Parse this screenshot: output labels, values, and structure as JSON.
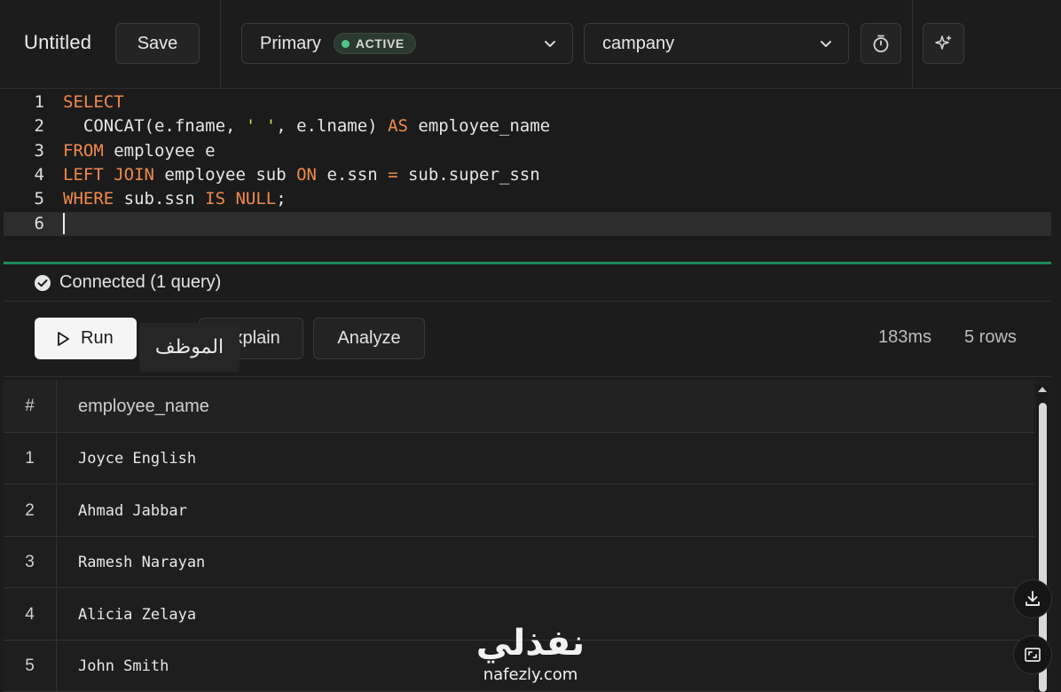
{
  "toolbar": {
    "title": "Untitled",
    "save_label": "Save",
    "connection": {
      "name": "Primary",
      "badge": "ACTIVE",
      "badge_color": "#4ec58a"
    },
    "database": {
      "name": "campany"
    },
    "icons": [
      "chevron-down-icon",
      "stopwatch-icon",
      "sparkle-icon"
    ]
  },
  "editor": {
    "line_numbers": [
      "1",
      "2",
      "3",
      "4",
      "5",
      "6"
    ],
    "lines": [
      [
        {
          "t": "SELECT",
          "k": "kw"
        }
      ],
      [
        {
          "t": "  CONCAT(e.fname, ",
          "k": ""
        },
        {
          "t": "' '",
          "k": "str"
        },
        {
          "t": ", e.lname) ",
          "k": ""
        },
        {
          "t": "AS",
          "k": "kw"
        },
        {
          "t": " employee_name",
          "k": ""
        }
      ],
      [
        {
          "t": "FROM",
          "k": "kw"
        },
        {
          "t": " employee e",
          "k": ""
        }
      ],
      [
        {
          "t": "LEFT JOIN",
          "k": "kw"
        },
        {
          "t": " employee sub ",
          "k": ""
        },
        {
          "t": "ON",
          "k": "kw"
        },
        {
          "t": " e.ssn ",
          "k": ""
        },
        {
          "t": "=",
          "k": "kw"
        },
        {
          "t": " sub.super_ssn",
          "k": ""
        }
      ],
      [
        {
          "t": "WHERE",
          "k": "kw"
        },
        {
          "t": " sub.ssn ",
          "k": ""
        },
        {
          "t": "IS NULL",
          "k": "kw"
        },
        {
          "t": ";",
          "k": ""
        }
      ],
      []
    ],
    "active_line": 6,
    "accent_color": "#1f8a5c",
    "keyword_color": "#f08a4b",
    "string_color": "#d8d35a"
  },
  "status": {
    "text": "Connected (1 query)",
    "icon": "check-circle-icon"
  },
  "actions": {
    "run_label": "Run",
    "explain_label": "Explain",
    "analyze_label": "Analyze",
    "tooltip": "الموظف",
    "duration": "183ms",
    "row_count": "5 rows"
  },
  "results": {
    "columns": [
      "#",
      "employee_name"
    ],
    "rows": [
      [
        "1",
        "Joyce English"
      ],
      [
        "2",
        "Ahmad Jabbar"
      ],
      [
        "3",
        "Ramesh Narayan"
      ],
      [
        "4",
        "Alicia Zelaya"
      ],
      [
        "5",
        "John Smith"
      ]
    ],
    "icons": [
      "download-icon",
      "expand-icon"
    ]
  },
  "watermark": {
    "arabic": "نفذلي",
    "latin": "nafezly.com"
  }
}
